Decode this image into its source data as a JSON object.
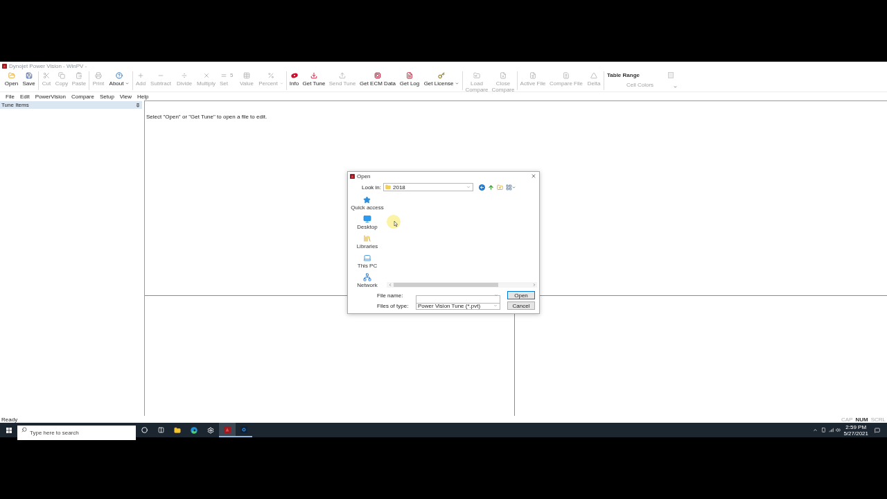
{
  "window": {
    "title": "Dynojet Power Vision - WinPV -"
  },
  "toolbar": {
    "groups": [
      {
        "items": [
          {
            "label": "Open",
            "disabled": false
          },
          {
            "label": "Save",
            "disabled": false
          }
        ]
      },
      {
        "items": [
          {
            "label": "Cut",
            "disabled": true
          },
          {
            "label": "Copy",
            "disabled": true
          },
          {
            "label": "Paste",
            "disabled": true
          }
        ]
      },
      {
        "items": [
          {
            "label": "Print",
            "disabled": true
          },
          {
            "label": "About",
            "disabled": false,
            "dropdown": true
          }
        ]
      },
      {
        "items": [
          {
            "label": "Add",
            "disabled": true
          },
          {
            "label": "Subtract",
            "disabled": true
          },
          {
            "label": "Divide",
            "disabled": true
          },
          {
            "label": "Multiply",
            "disabled": true
          },
          {
            "label": "Set",
            "disabled": true,
            "value": "5"
          },
          {
            "label": "Value",
            "disabled": true
          },
          {
            "label": "Percent",
            "disabled": true,
            "dropdown": true
          }
        ]
      },
      {
        "items": [
          {
            "label": "Info",
            "disabled": false
          },
          {
            "label": "Get Tune",
            "disabled": false
          },
          {
            "label": "Send Tune",
            "disabled": true
          },
          {
            "label": "Get ECM Data",
            "disabled": false
          },
          {
            "label": "Get Log",
            "disabled": false
          },
          {
            "label": "Get License",
            "disabled": false,
            "dropdown": true
          }
        ]
      },
      {
        "items": [
          {
            "label": "Load Compare",
            "disabled": true
          },
          {
            "label": "Close Compare",
            "disabled": true
          }
        ]
      },
      {
        "items": [
          {
            "label": "Active File",
            "disabled": true
          },
          {
            "label": "Compare File",
            "disabled": true
          },
          {
            "label": "Delta",
            "disabled": true
          }
        ]
      }
    ],
    "table_range": {
      "title": "Table Range",
      "cell_colors": {
        "label": "Cell Colors",
        "disabled": true
      }
    }
  },
  "menu": [
    "File",
    "Edit",
    "PowerVision",
    "Compare",
    "Setup",
    "View",
    "Help"
  ],
  "sidebar": {
    "title": "Tune Items"
  },
  "editor": {
    "hint": "Select \"Open\" or \"Get Tune\" to open a file to edit."
  },
  "dialog": {
    "title": "Open",
    "look_in": {
      "label": "Look in:",
      "value": "2018"
    },
    "places": [
      "Quick access",
      "Desktop",
      "Libraries",
      "This PC",
      "Network"
    ],
    "file_name": {
      "label": "File name:"
    },
    "file_type": {
      "label": "Files of type:",
      "value": "Power Vision Tune (*.pvt)"
    },
    "buttons": [
      {
        "label": "Open",
        "default": true
      },
      {
        "label": "Cancel",
        "default": false
      }
    ]
  },
  "status_bar": {
    "text": "Ready",
    "indicators": [
      {
        "label": "CAP",
        "on": false
      },
      {
        "label": "NUM",
        "on": true
      },
      {
        "label": "SCRL",
        "on": false
      }
    ]
  },
  "taskbar": {
    "search": {
      "placeholder": "Type here to search"
    },
    "apps": [
      {
        "selected": false,
        "running": false
      },
      {
        "selected": false,
        "running": false
      },
      {
        "selected": false,
        "running": false
      },
      {
        "selected": false,
        "running": false
      },
      {
        "selected": false,
        "running": false
      },
      {
        "selected": true,
        "running": true
      },
      {
        "selected": false,
        "running": true
      }
    ],
    "time": "2:59 PM",
    "date": "5/27/2021"
  }
}
